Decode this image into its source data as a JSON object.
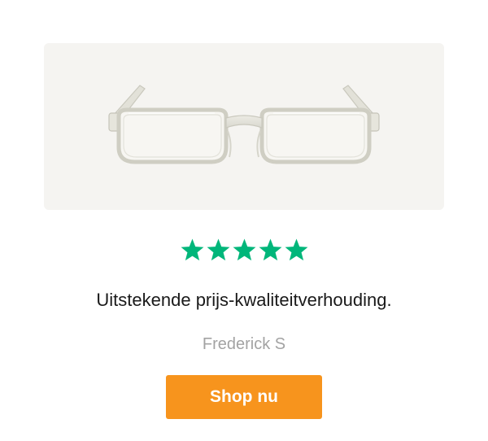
{
  "product": {
    "image_alt": "Transparent reading glasses"
  },
  "rating": {
    "stars": 5,
    "max": 5,
    "color": "#00b67a"
  },
  "review": {
    "text": "Uitstekende prijs-kwaliteitverhouding.",
    "author": "Frederick S"
  },
  "cta": {
    "label": "Shop nu",
    "color": "#f7941d"
  }
}
